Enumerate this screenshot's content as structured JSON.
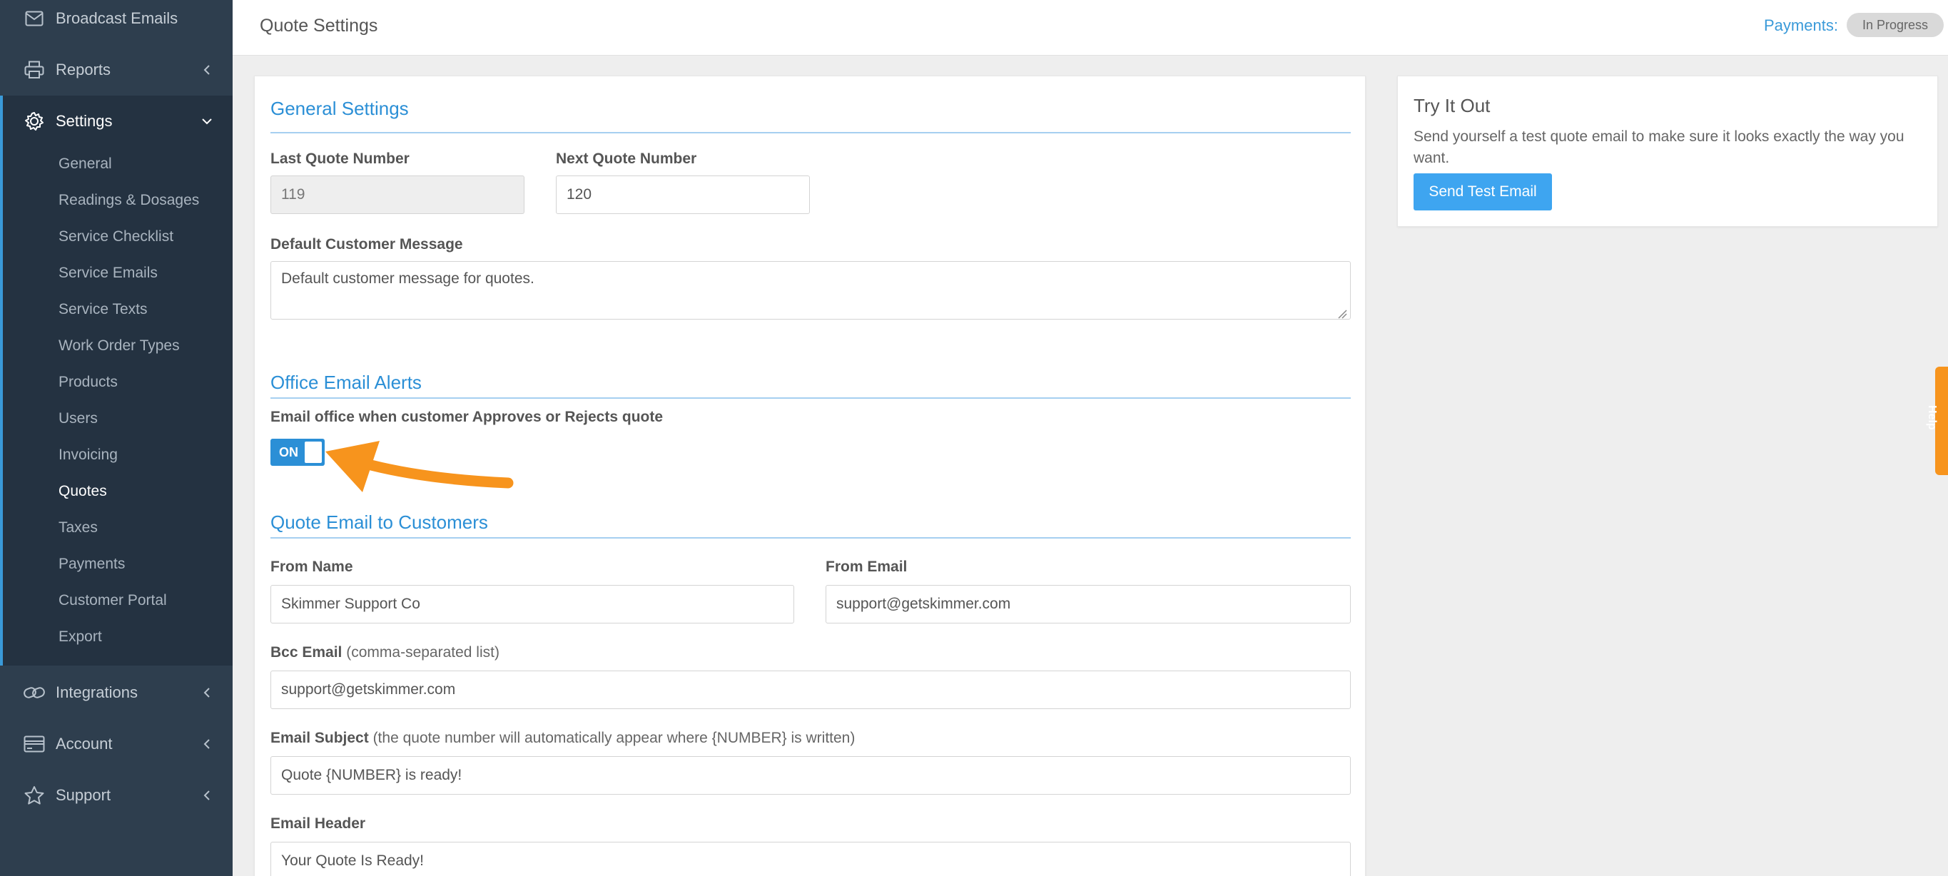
{
  "sidebar": {
    "items": [
      {
        "label": "Broadcast Emails",
        "icon": "envelope-icon"
      },
      {
        "label": "Reports",
        "icon": "printer-icon"
      },
      {
        "label": "Settings",
        "icon": "gear-icon"
      },
      {
        "label": "Integrations",
        "icon": "link-icon"
      },
      {
        "label": "Account",
        "icon": "credit-card-icon"
      },
      {
        "label": "Support",
        "icon": "star-icon"
      }
    ],
    "settings_sub": [
      "General",
      "Readings & Dosages",
      "Service Checklist",
      "Service Emails",
      "Service Texts",
      "Work Order Types",
      "Products",
      "Users",
      "Invoicing",
      "Quotes",
      "Taxes",
      "Payments",
      "Customer Portal",
      "Export"
    ],
    "active_sub": "Quotes"
  },
  "header": {
    "title": "Quote Settings",
    "payments_label": "Payments:",
    "payments_status": "In Progress"
  },
  "general": {
    "title": "General Settings",
    "last_quote_label": "Last Quote Number",
    "last_quote_value": "119",
    "next_quote_label": "Next Quote Number",
    "next_quote_value": "120",
    "message_label": "Default Customer Message",
    "message_value": "Default customer message for quotes."
  },
  "alerts": {
    "title": "Office Email Alerts",
    "toggle_label": "Email office when customer Approves or Rejects quote",
    "toggle_state": "ON"
  },
  "quote_email": {
    "title": "Quote Email to Customers",
    "from_name_label": "From Name",
    "from_name_value": "Skimmer Support Co",
    "from_email_label": "From Email",
    "from_email_value": "support@getskimmer.com",
    "bcc_label": "Bcc Email",
    "bcc_hint": "(comma-separated list)",
    "bcc_value": "support@getskimmer.com",
    "subject_label": "Email Subject",
    "subject_hint": "(the quote number will automatically appear where {NUMBER} is written)",
    "subject_value": "Quote {NUMBER} is ready!",
    "header_label": "Email Header",
    "header_value": "Your Quote Is Ready!"
  },
  "try_it": {
    "title": "Try It Out",
    "text": "Send yourself a test quote email to make sure it looks exactly the way you want.",
    "button": "Send Test Email"
  },
  "help_tab": "Help",
  "colors": {
    "sidebar": "#2e3e4e",
    "accent": "#2b8fd6",
    "button": "#3ea5f0",
    "annotation_arrow": "#f7941d"
  }
}
